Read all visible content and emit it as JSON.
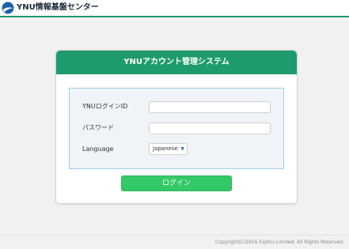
{
  "header": {
    "logo_text": "YNU情報基盤センター",
    "logo_icon": "ynu-logo-icon",
    "accent_color": "#1d9b6c"
  },
  "login_card": {
    "title": "YNUアカウント管理システム",
    "fields": {
      "user_id_label": "YNUログインID",
      "user_id_value": "",
      "password_label": "パスワード",
      "password_value": "",
      "language_label": "Language",
      "language_value": "Japanese",
      "language_icon": "dropdown-triangle-icon"
    },
    "login_button_label": "ログイン",
    "button_color": "#33c967"
  },
  "footer": {
    "copyright": "Copyright(C)2016 Fujitsu Limited, All Rights Reserved."
  }
}
